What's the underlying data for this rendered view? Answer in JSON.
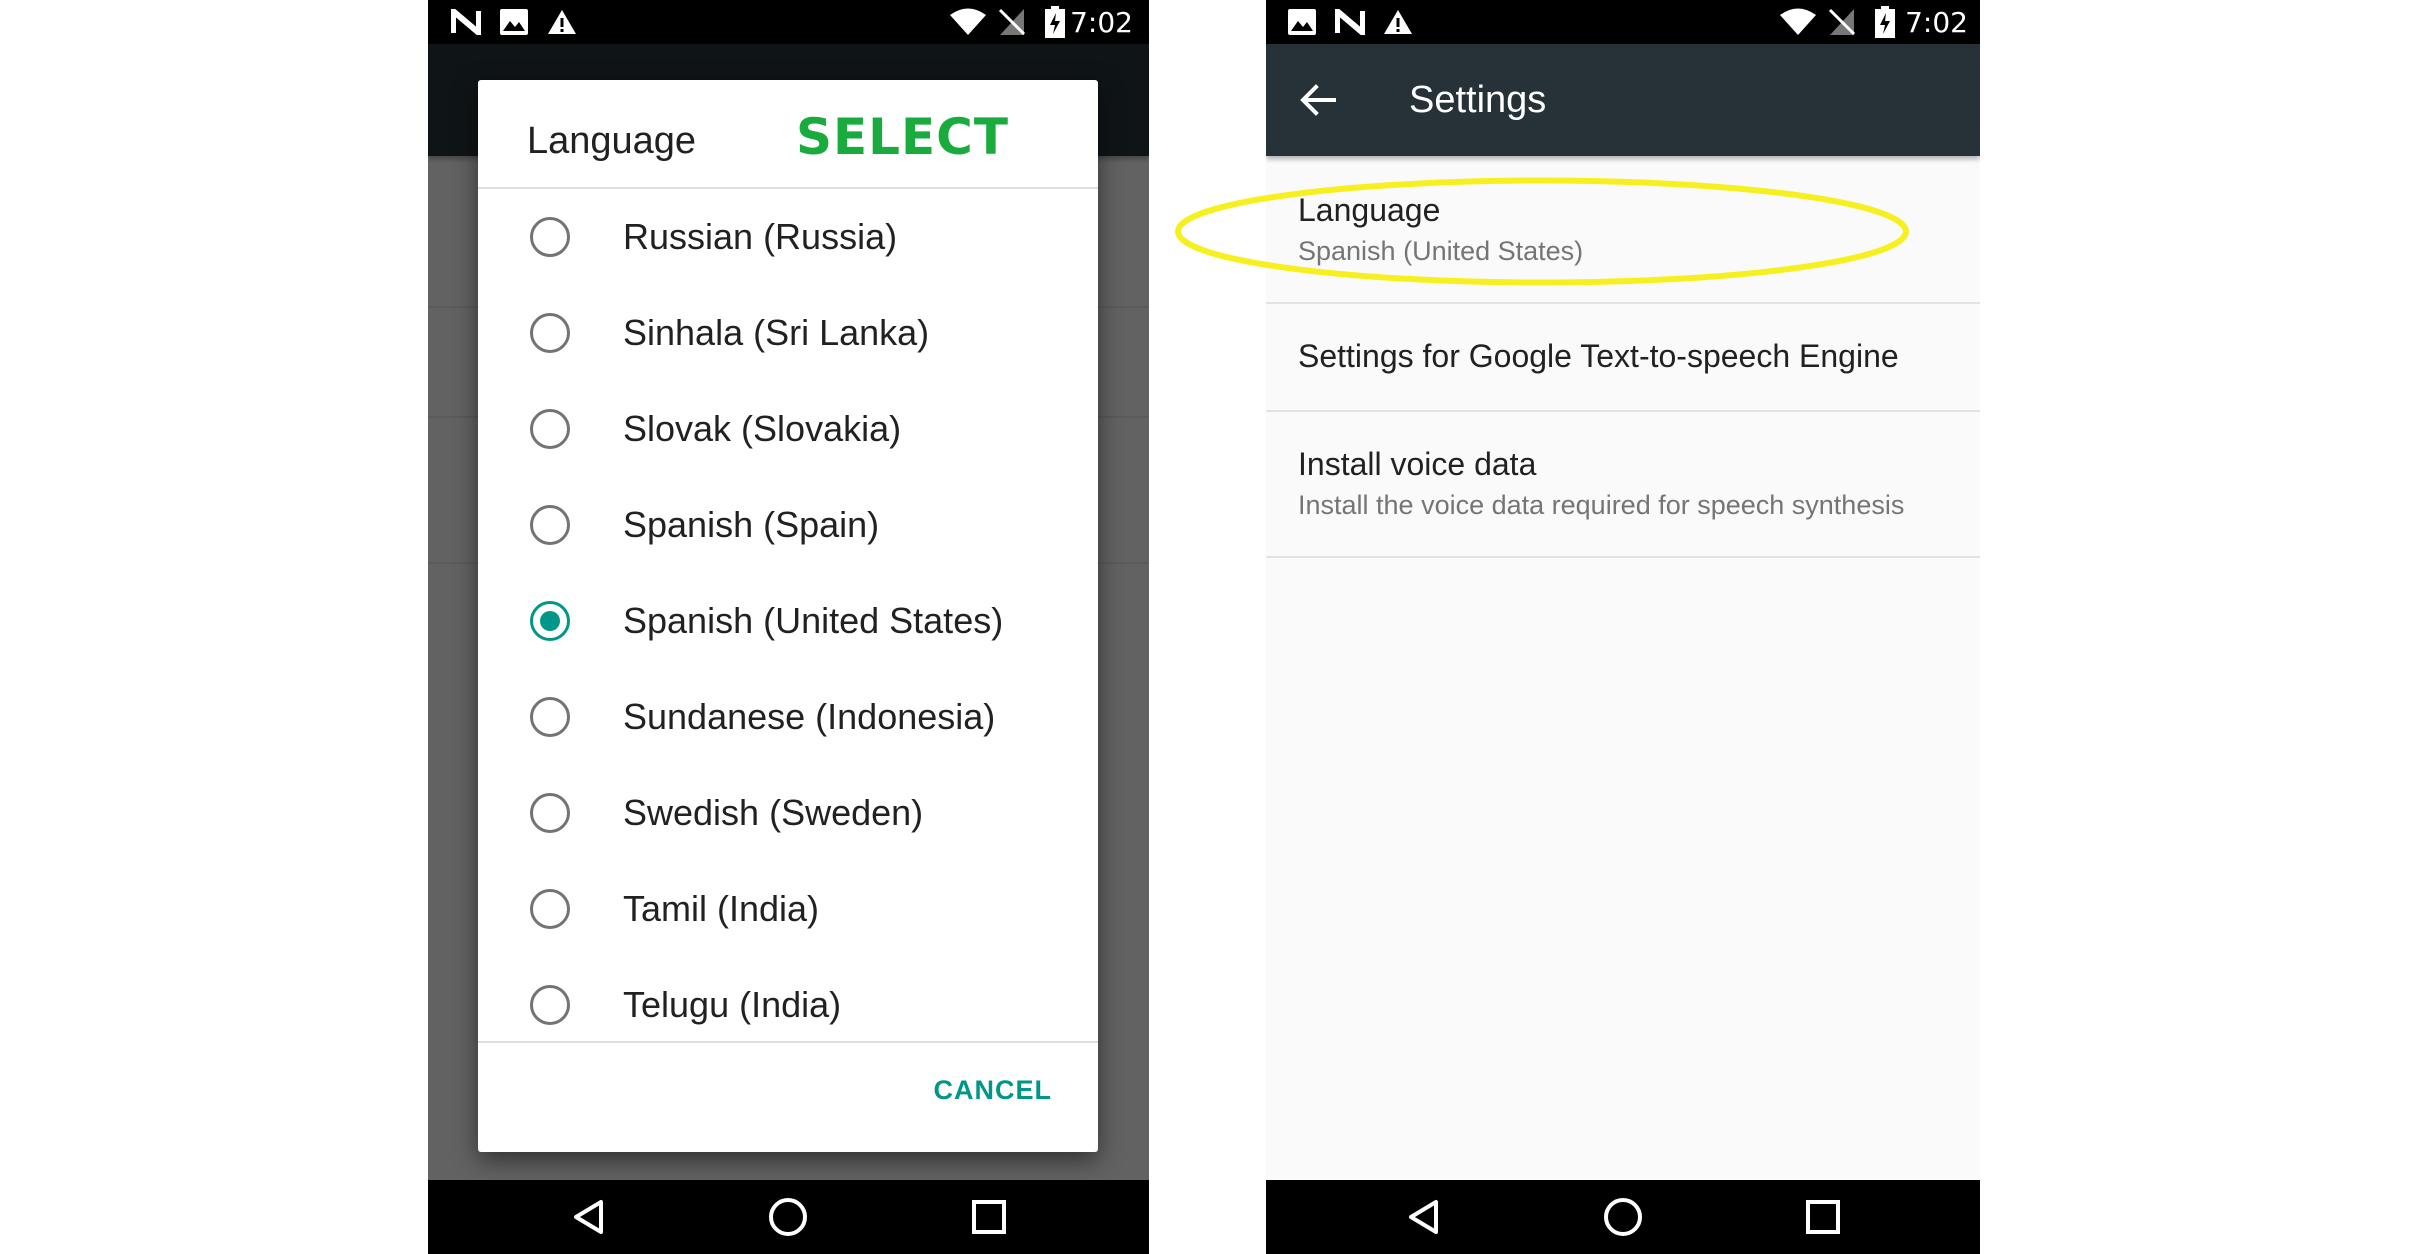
{
  "left_screen": {
    "status_bar": {
      "time": "7:02",
      "icons": [
        "n-logo-icon",
        "image-icon",
        "warning-icon",
        "wifi-icon",
        "no-sim-icon",
        "battery-charging-icon"
      ]
    },
    "dialog": {
      "title": "Language",
      "options": [
        {
          "label": "Russian (Russia)",
          "selected": false
        },
        {
          "label": "Sinhala (Sri Lanka)",
          "selected": false
        },
        {
          "label": "Slovak (Slovakia)",
          "selected": false
        },
        {
          "label": "Spanish (Spain)",
          "selected": false
        },
        {
          "label": "Spanish (United States)",
          "selected": true
        },
        {
          "label": "Sundanese (Indonesia)",
          "selected": false
        },
        {
          "label": "Swedish (Sweden)",
          "selected": false
        },
        {
          "label": "Tamil (India)",
          "selected": false
        },
        {
          "label": "Telugu (India)",
          "selected": false
        }
      ],
      "cancel_label": "CANCEL"
    },
    "annotation": "SELECT"
  },
  "right_screen": {
    "status_bar": {
      "time": "7:02",
      "icons": [
        "image-icon",
        "n-logo-icon",
        "warning-icon",
        "wifi-icon",
        "no-sim-icon",
        "battery-charging-icon"
      ]
    },
    "app_bar": {
      "title": "Settings"
    },
    "preferences": [
      {
        "title": "Language",
        "summary": "Spanish (United States)"
      },
      {
        "title": "Settings for Google Text-to-speech Engine",
        "summary": ""
      },
      {
        "title": "Install voice data",
        "summary": "Install the voice data required for speech synthesis"
      }
    ]
  },
  "colors": {
    "accent": "#009688",
    "app_bar": "#263238",
    "annotation_text": "#1aab3e",
    "highlight": "#f7f01f"
  },
  "nav_bar": {
    "icons": [
      "back-triangle-icon",
      "home-circle-icon",
      "recents-square-icon"
    ]
  }
}
